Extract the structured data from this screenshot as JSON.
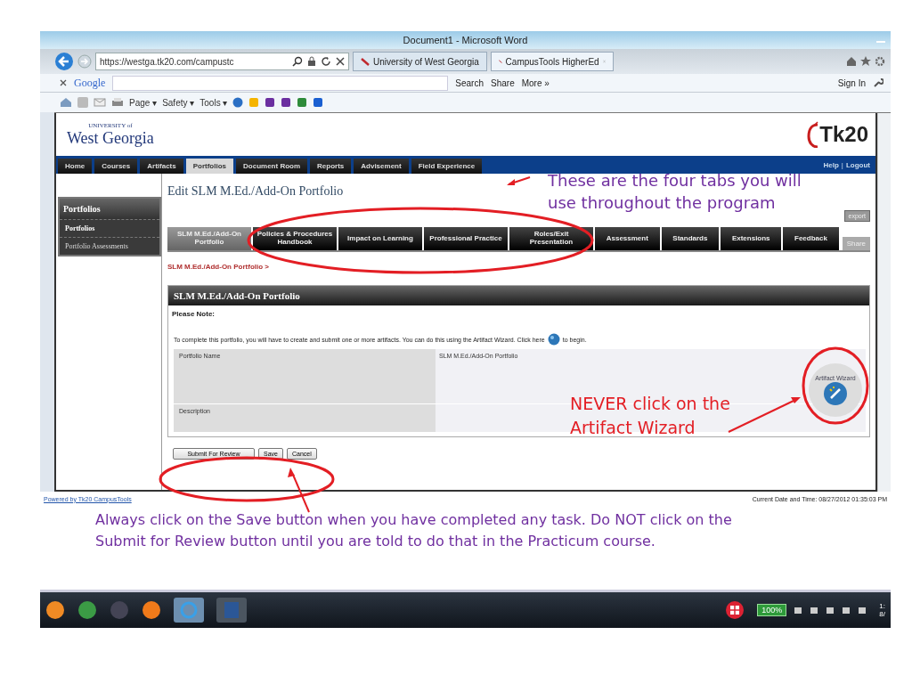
{
  "word_window": {
    "title": "Document1 - Microsoft Word"
  },
  "browser": {
    "address": "https://westga.tk20.com/campustc",
    "tabs": [
      {
        "label": "University of West Georgia",
        "selected": false
      },
      {
        "label": "CampusTools HigherEd",
        "selected": true
      }
    ],
    "google_bar": {
      "label": "Google",
      "items": [
        "Search",
        "Share",
        "More »"
      ],
      "sign_in": "Sign In"
    },
    "command_bar": [
      "Page ▾",
      "Safety ▾",
      "Tools ▾"
    ]
  },
  "page": {
    "logo_top": "UNIVERSITY of",
    "logo_main": "West Georgia",
    "brand": "Tk20",
    "nav": [
      {
        "label": "Home",
        "selected": false
      },
      {
        "label": "Courses",
        "selected": false
      },
      {
        "label": "Artifacts",
        "selected": false
      },
      {
        "label": "Portfolios",
        "selected": true
      },
      {
        "label": "Document Room",
        "selected": false
      },
      {
        "label": "Reports",
        "selected": false
      },
      {
        "label": "Advisement",
        "selected": false
      },
      {
        "label": "Field Experience",
        "selected": false
      }
    ],
    "help_links": [
      "Help",
      "Logout"
    ],
    "help_separator": "|",
    "sidebar": {
      "title": "Portfolios",
      "items": [
        {
          "label": "Portfolios",
          "selected": true
        },
        {
          "label": "Portfolio Assessments",
          "selected": false
        }
      ]
    },
    "heading": "Edit SLM M.Ed./Add-On Portfolio",
    "export": "export",
    "share": "Share",
    "tabs": [
      {
        "label": "SLM M.Ed./Add-On Portfolio",
        "selected": true
      },
      {
        "label": "Policies & Procedures Handbook",
        "selected": false
      },
      {
        "label": "Impact on Learning",
        "selected": false
      },
      {
        "label": "Professional Practice",
        "selected": false
      },
      {
        "label": "Roles/Exit Presentation",
        "selected": false
      },
      {
        "label": "Assessment",
        "selected": false
      },
      {
        "label": "Standards",
        "selected": false
      },
      {
        "label": "Extensions",
        "selected": false
      },
      {
        "label": "Feedback",
        "selected": false
      }
    ],
    "breadcrumb": "SLM M.Ed./Add-On Portfolio >",
    "panel": {
      "title": "SLM M.Ed./Add-On Portfolio",
      "note_label": "Please Note:",
      "note": "To complete this portfolio, you will have to create and submit one or more artifacts. You can do this using the Artifact Wizard. Click here",
      "note_end": "to begin.",
      "fields": [
        {
          "label": "Portfolio Name",
          "value": "SLM M.Ed./Add-On Portfolio"
        },
        {
          "label": "Description"
        }
      ],
      "wizard_label": "Artifact Wizard"
    },
    "buttons": [
      "Submit For Review",
      "Save",
      "Cancel"
    ],
    "footer_link": "Powered by Tk20 CampusTools",
    "footer_time": "Current Date and Time: 08/27/2012 01:35:03 PM"
  },
  "annotations": [
    {
      "text": "These are the four tabs you will use throughout the program",
      "color": "#7030a0"
    },
    {
      "text": "NEVER click on the Artifact Wizard",
      "color": "#e31e24"
    },
    {
      "text": "Always click on the Save button when you have completed any task. Do NOT click on the Submit for Review button until you are told to do that in the Practicum course.",
      "color": "#7030a0"
    }
  ],
  "taskbar": {
    "battery": "100%",
    "clock": "1:",
    "date": "8/"
  }
}
